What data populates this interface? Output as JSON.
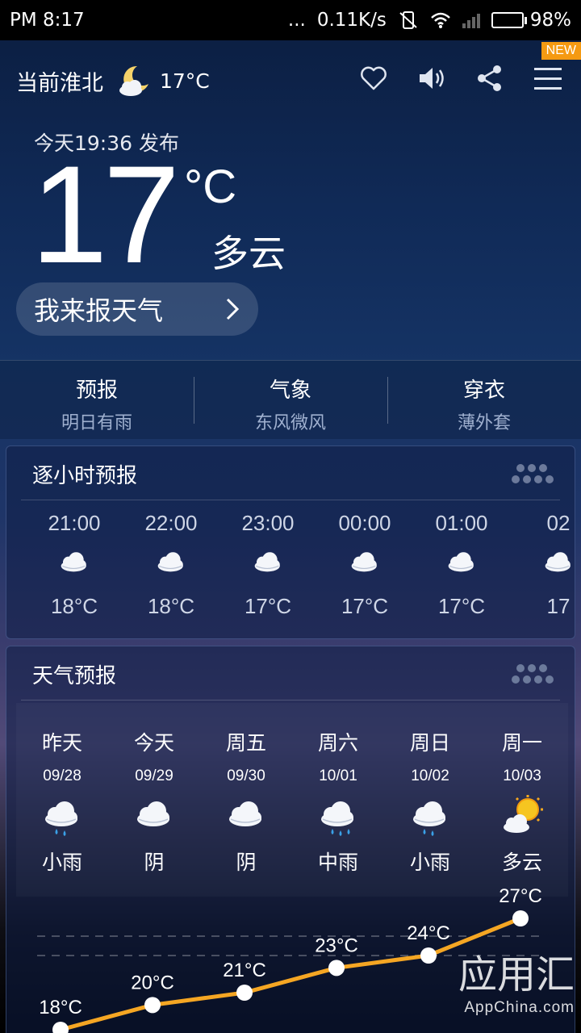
{
  "status_bar": {
    "time": "PM 8:17",
    "dots": "...",
    "speed": "0.11K/s",
    "battery": "98%"
  },
  "header": {
    "city": "当前淮北",
    "temp": "17°C",
    "badge": "NEW"
  },
  "current": {
    "published": "今天19:36 发布",
    "temperature": "17",
    "unit": "°C",
    "condition": "多云",
    "report_button": "我来报天气"
  },
  "summary": [
    {
      "title": "预报",
      "sub": "明日有雨"
    },
    {
      "title": "气象",
      "sub": "东风微风"
    },
    {
      "title": "穿衣",
      "sub": "薄外套"
    }
  ],
  "hourly": {
    "title": "逐小时预报",
    "items": [
      {
        "time": "21:00",
        "temp": "18°C",
        "icon": "cloudy-icon"
      },
      {
        "time": "22:00",
        "temp": "18°C",
        "icon": "cloudy-icon"
      },
      {
        "time": "23:00",
        "temp": "17°C",
        "icon": "cloudy-icon"
      },
      {
        "time": "00:00",
        "temp": "17°C",
        "icon": "cloudy-icon"
      },
      {
        "time": "01:00",
        "temp": "17°C",
        "icon": "cloudy-icon"
      },
      {
        "time": "02",
        "temp": "17",
        "icon": "cloudy-icon"
      }
    ]
  },
  "daily": {
    "title": "天气预报",
    "items": [
      {
        "day": "昨天",
        "date": "09/28",
        "desc": "小雨",
        "icon": "light-rain-icon"
      },
      {
        "day": "今天",
        "date": "09/29",
        "desc": "阴",
        "icon": "overcast-icon"
      },
      {
        "day": "周五",
        "date": "09/30",
        "desc": "阴",
        "icon": "overcast-icon"
      },
      {
        "day": "周六",
        "date": "10/01",
        "desc": "中雨",
        "icon": "moderate-rain-icon"
      },
      {
        "day": "周日",
        "date": "10/02",
        "desc": "小雨",
        "icon": "light-rain-icon"
      },
      {
        "day": "周一",
        "date": "10/03",
        "desc": "多云",
        "icon": "partly-cloudy-icon"
      }
    ]
  },
  "chart_data": {
    "type": "line",
    "categories": [
      "昨天",
      "今天",
      "周五",
      "周六",
      "周日",
      "周一"
    ],
    "series": [
      {
        "values": [
          18,
          20,
          21,
          23,
          24,
          27
        ]
      }
    ],
    "labels": [
      "18°C",
      "20°C",
      "21°C",
      "23°C",
      "24°C",
      "27°C"
    ]
  },
  "watermark": {
    "big": "应用汇",
    "small": "AppChina.com"
  },
  "colors": {
    "line": "#f5a623",
    "battery": "#27d827",
    "badge": "#f59a12"
  }
}
